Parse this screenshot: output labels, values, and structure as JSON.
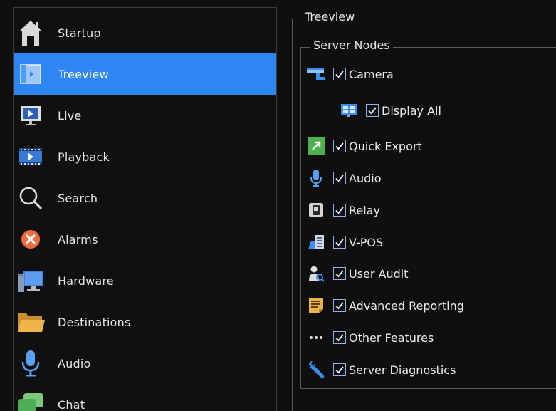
{
  "nav": {
    "items": [
      {
        "label": "Startup",
        "icon": "home-icon"
      },
      {
        "label": "Treeview",
        "icon": "treeview-icon",
        "active": true
      },
      {
        "label": "Live",
        "icon": "live-monitor-icon"
      },
      {
        "label": "Playback",
        "icon": "playback-film-icon"
      },
      {
        "label": "Search",
        "icon": "search-icon"
      },
      {
        "label": "Alarms",
        "icon": "alarm-x-icon"
      },
      {
        "label": "Hardware",
        "icon": "hardware-computer-icon"
      },
      {
        "label": "Destinations",
        "icon": "folder-icon"
      },
      {
        "label": "Audio",
        "icon": "microphone-icon"
      },
      {
        "label": "Chat",
        "icon": "chat-icon"
      }
    ]
  },
  "treeview": {
    "title": "Treeview",
    "server_nodes": {
      "title": "Server Nodes",
      "items": [
        {
          "label": "Camera",
          "checked": true,
          "icon": "camera-icon"
        },
        {
          "label": "Display All",
          "checked": true,
          "icon": "display-grid-icon"
        },
        {
          "label": "Quick Export",
          "checked": true,
          "icon": "quick-export-icon"
        },
        {
          "label": "Audio",
          "checked": true,
          "icon": "microphone-icon"
        },
        {
          "label": "Relay",
          "checked": true,
          "icon": "relay-icon"
        },
        {
          "label": "V-POS",
          "checked": true,
          "icon": "vpos-register-icon"
        },
        {
          "label": "User Audit",
          "checked": true,
          "icon": "user-audit-icon"
        },
        {
          "label": "Advanced Reporting",
          "checked": true,
          "icon": "report-icon"
        },
        {
          "label": "Other Features",
          "checked": true,
          "icon": "ellipsis-icon"
        },
        {
          "label": "Server Diagnostics",
          "checked": true,
          "icon": "wrench-icon"
        }
      ]
    }
  },
  "colors": {
    "accent": "#2e86f4",
    "background": "#0f0f0f",
    "border": "#5a5a5a"
  }
}
